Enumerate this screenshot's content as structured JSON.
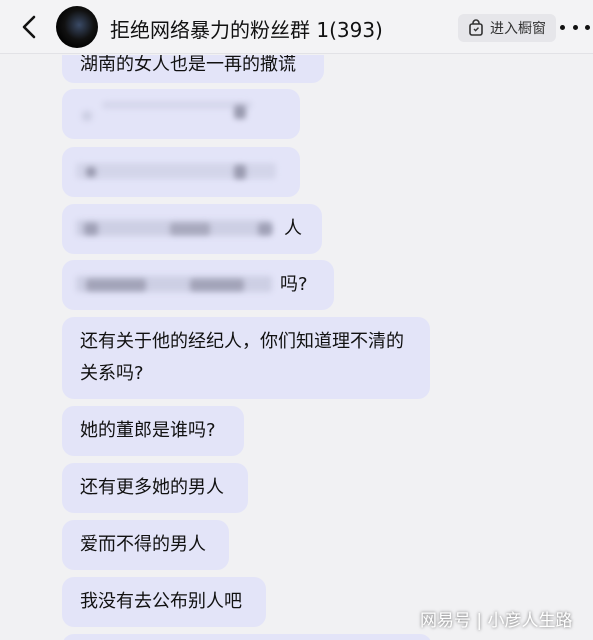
{
  "header": {
    "group_title": "拒绝网络暴力的粉丝群 1(393)",
    "window_button_label": "进入橱窗",
    "back_icon": "chevron-left-icon",
    "more_icon": "more-dots-icon",
    "window_icon": "bag-icon"
  },
  "messages": [
    {
      "text": "湖南的女人也是一再的撒谎"
    },
    {
      "text": ""
    },
    {
      "text": ""
    },
    {
      "text": "人"
    },
    {
      "text": "吗?"
    },
    {
      "text_line1": "还有关于他的经纪人，你们知道理不清的",
      "text_line2": "关系吗?"
    },
    {
      "text": "她的董郎是谁吗?"
    },
    {
      "text": "还有更多她的男人"
    },
    {
      "text": "爱而不得的男人"
    },
    {
      "text": "我没有去公布别人吧"
    }
  ],
  "watermark": "网易号 | 小彦人生路",
  "colors": {
    "bubble": "#e3e4f8",
    "background": "#f1f1f3"
  }
}
